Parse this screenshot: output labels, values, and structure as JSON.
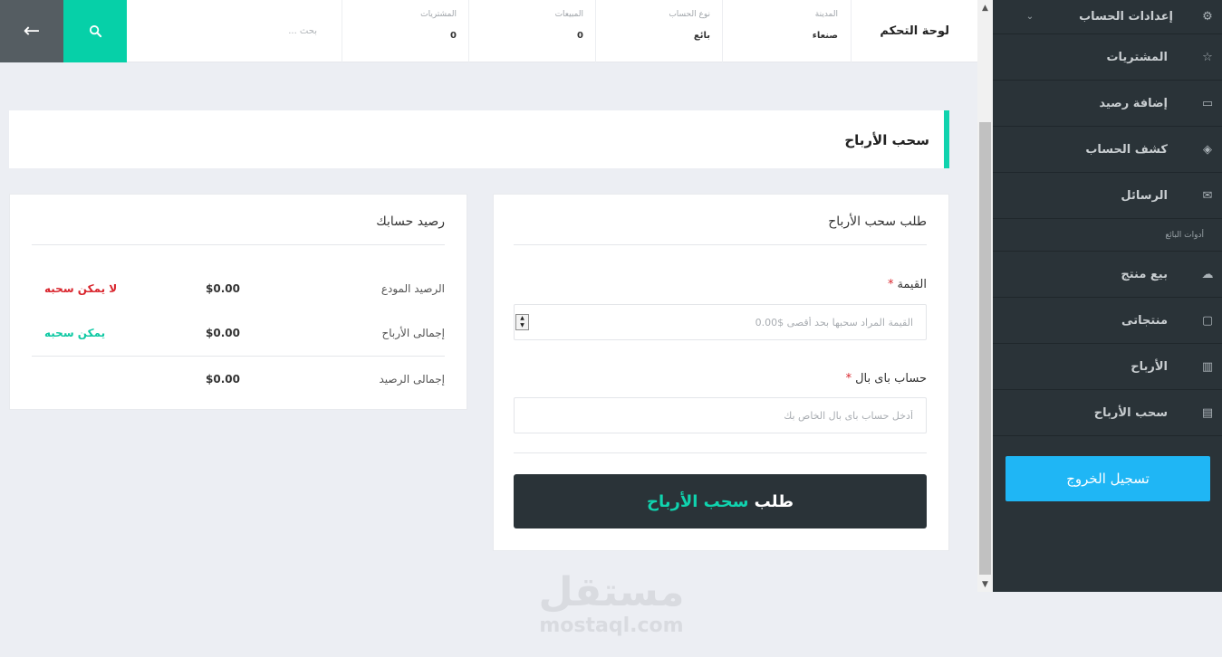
{
  "sidebar": {
    "items": [
      {
        "label": "إعدادات الحساب",
        "icon": "gear-icon",
        "glyph": "⚙"
      },
      {
        "label": "المشتريات",
        "icon": "star-icon",
        "glyph": "☆"
      },
      {
        "label": "إضافة رصيد",
        "icon": "card-icon",
        "glyph": "▭"
      },
      {
        "label": "كشف الحساب",
        "icon": "layers-icon",
        "glyph": "◈"
      },
      {
        "label": "الرسائل",
        "icon": "envelope-icon",
        "glyph": "✉"
      }
    ],
    "section_label": "أدوات البائع",
    "seller_items": [
      {
        "label": "بيع منتج",
        "icon": "cloud-upload-icon",
        "glyph": "☁"
      },
      {
        "label": "منتجاتى",
        "icon": "folder-icon",
        "glyph": "▢"
      },
      {
        "label": "الأرباح",
        "icon": "bar-chart-icon",
        "glyph": "▥"
      },
      {
        "label": "سحب الأرباح",
        "icon": "folder-open-icon",
        "glyph": "▤"
      }
    ],
    "logout_label": "تسجيل الخروج"
  },
  "topbar": {
    "title": "لوحة التحكم",
    "search_placeholder": "بحث ...",
    "stats": [
      {
        "label": "المدينة",
        "value": "صنعاء"
      },
      {
        "label": "نوع الحساب",
        "value": "بائع"
      },
      {
        "label": "المبيعات",
        "value": "0"
      },
      {
        "label": "المشتريات",
        "value": "0"
      }
    ]
  },
  "page": {
    "title": "سحب الأرباح"
  },
  "form": {
    "title": "طلب سحب الأرباح",
    "amount_label": "القيمة",
    "amount_placeholder": "القيمة المراد سحبها بحد أقصى $0.00",
    "paypal_label": "حساب باى بال",
    "paypal_placeholder": "أدخل حساب باى بال الخاص بك",
    "required_mark": "*",
    "submit_prefix": "طلب",
    "submit_accent": "سحب الأرباح"
  },
  "balance": {
    "title": "رصيد حسابك",
    "rows": [
      {
        "label": "الرصيد المودع",
        "value": "$0.00",
        "status": "لا يمكن سحبه",
        "status_color": "#d9262e"
      },
      {
        "label": "إجمالى الأرباح",
        "value": "$0.00",
        "status": "يمكن سحبه",
        "status_color": "#10c9a4"
      },
      {
        "label": "إجمالى الرصيد",
        "value": "$0.00",
        "status": "",
        "status_color": "#333333"
      }
    ]
  },
  "watermark": {
    "arabic": "مستقل",
    "latin": "mostaql.com"
  },
  "colors": {
    "accent": "#10d3ae",
    "sidebar_bg": "#2a3338",
    "logout": "#1fb6f5",
    "danger": "#d9262e"
  }
}
